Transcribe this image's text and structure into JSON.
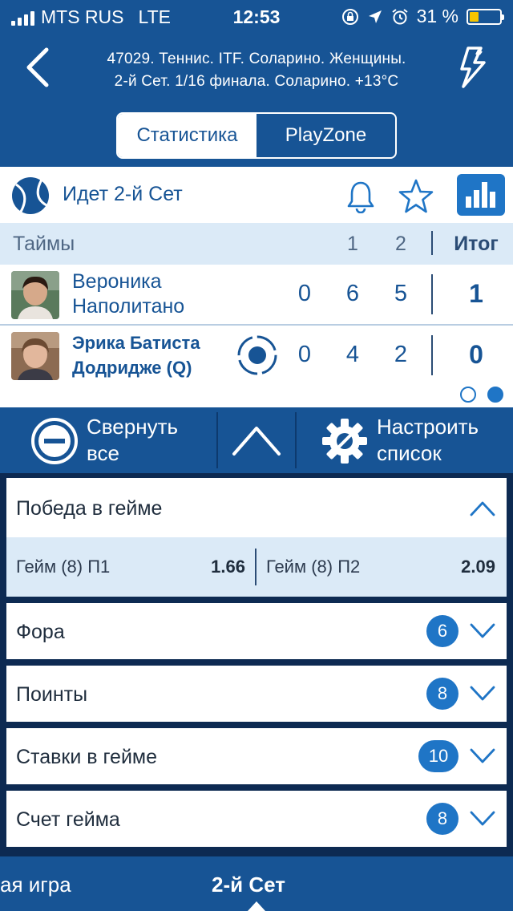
{
  "status_bar": {
    "carrier": "MTS RUS",
    "network": "LTE",
    "time": "12:53",
    "battery": "31 %",
    "battery_level": 0.31
  },
  "header": {
    "title_line1": "47029. Теннис. ITF. Соларино. Женщины.",
    "title_line2": "2-й  Сет. 1/16 финала. Соларино. +13°C",
    "back_icon": "chevron-left-icon",
    "action_icon": "lightning-icon"
  },
  "segments": {
    "stats": "Статистика",
    "playzone": "PlayZone",
    "selected": "stats"
  },
  "match": {
    "status": "Идет 2-й  Сет",
    "score_header": {
      "label": "Таймы",
      "col1": "1",
      "col2": "2",
      "total": "Итог"
    },
    "players": [
      {
        "name": "Вероника Наполитано",
        "scores": [
          "0",
          "6",
          "5"
        ],
        "total": "1"
      },
      {
        "name": "Эрика Батиста Додридже (Q)",
        "scores": [
          "0",
          "4",
          "2"
        ],
        "total": "0",
        "serving": true
      }
    ],
    "pager_active": 1
  },
  "toolbar": {
    "collapse": "Свернуть все",
    "settings": "Настроить список"
  },
  "markets": {
    "open": {
      "name": "Победа в гейме",
      "odds": [
        {
          "name": "Гейм (8) П1",
          "value": "1.66"
        },
        {
          "name": "Гейм (8) П2",
          "value": "2.09"
        }
      ]
    },
    "items": [
      {
        "name": "Фора",
        "count": "6"
      },
      {
        "name": "Поинты",
        "count": "8"
      },
      {
        "name": "Ставки в гейме",
        "count": "10"
      },
      {
        "name": "Счет гейма",
        "count": "8"
      }
    ]
  },
  "bottom_tabs": {
    "prev": "ая игра",
    "current": "2-й  Сет"
  },
  "colors": {
    "primary": "#175495",
    "accent": "#1f75c6",
    "light_band": "#dbeaf7",
    "battery": "#f5c400"
  }
}
